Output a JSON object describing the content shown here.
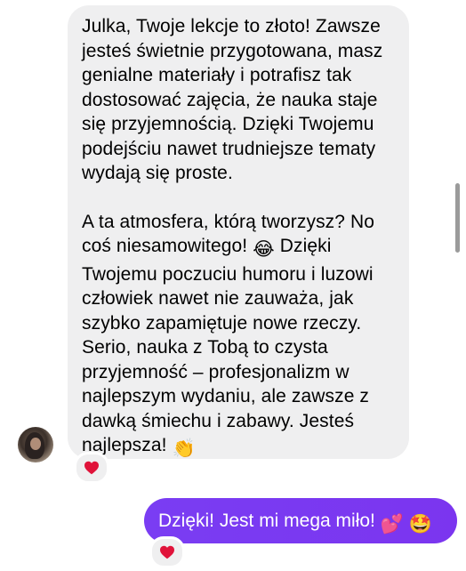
{
  "incoming_message": {
    "paragraph1": "Julka, Twoje lekcje to złoto! Zawsze\njesteś świetnie przygotowana, masz\ngenialne materiały i potrafisz tak\ndostosować zajęcia, że nauka staje\nsię przyjemnością. Dzięki Twojemu\npodejściu nawet trudniejsze tematy\nwydają się proste.",
    "paragraph2_part1": "A ta atmosfera, którą tworzysz? No\ncoś niesamowitego! ",
    "emoji_laugh": "😂",
    "paragraph2_part2": " Dzięki\nTwojemu poczuciu humoru i luzowi\nczłowiek nawet nie zauważa, jak\nszybko zapamiętuje nowe rzeczy.\nSerio, nauka z Tobą to czysta\nprzyjemność – profesjonalizm w\nnajlepszym wydaniu, ale zawsze z\ndawką śmiechu i zabawy. Jesteś\nnajlepsza! ",
    "emoji_clap": "👏",
    "reaction": "❤️"
  },
  "outgoing_message": {
    "text": "Dzięki! Jest mi mega miło! ",
    "emoji_hearts": "💕",
    "emoji_star": "🤩",
    "reaction": "❤️"
  },
  "colors": {
    "incoming_bubble": "#efeff0",
    "outgoing_bubble": "#7b3cf2",
    "heart": "#e0133a"
  }
}
